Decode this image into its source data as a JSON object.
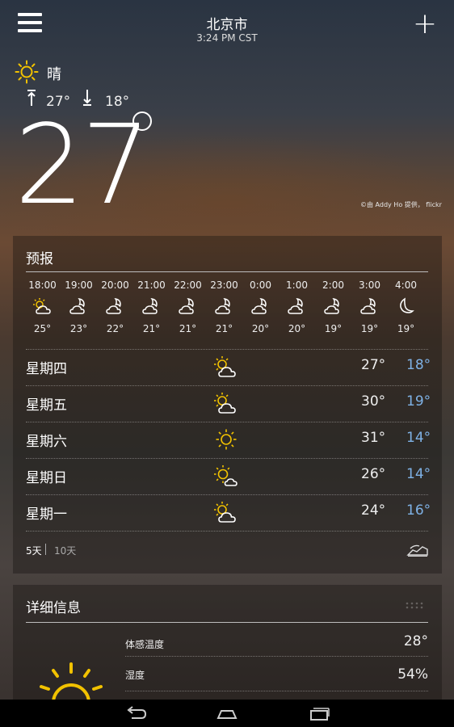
{
  "header": {
    "city": "北京市",
    "time": "3:24 PM CST",
    "menu_icon": "menu-icon",
    "add_icon": "plus-icon",
    "add_label": "+"
  },
  "current": {
    "condition": "晴",
    "condition_icon": "sun-icon",
    "high": "27°",
    "low": "18°",
    "temp": "27",
    "photo_credit": "©由 Addy Ho 提供， flickr"
  },
  "forecast": {
    "title": "预报",
    "hourly": [
      {
        "time": "18:00",
        "icon": "partly-sunny-icon",
        "temp": "25°"
      },
      {
        "time": "19:00",
        "icon": "moon-cloud-icon",
        "temp": "23°"
      },
      {
        "time": "20:00",
        "icon": "moon-cloud-icon",
        "temp": "22°"
      },
      {
        "time": "21:00",
        "icon": "moon-cloud-icon",
        "temp": "21°"
      },
      {
        "time": "22:00",
        "icon": "moon-cloud-icon",
        "temp": "21°"
      },
      {
        "time": "23:00",
        "icon": "moon-cloud-icon",
        "temp": "21°"
      },
      {
        "time": "0:00",
        "icon": "moon-cloud-icon",
        "temp": "20°"
      },
      {
        "time": "1:00",
        "icon": "moon-cloud-icon",
        "temp": "20°"
      },
      {
        "time": "2:00",
        "icon": "moon-cloud-icon",
        "temp": "19°"
      },
      {
        "time": "3:00",
        "icon": "moon-cloud-icon",
        "temp": "19°"
      },
      {
        "time": "4:00",
        "icon": "moon-icon",
        "temp": "19°"
      }
    ],
    "daily": [
      {
        "day": "星期四",
        "icon": "partly-sunny-icon",
        "high": "27°",
        "low": "18°"
      },
      {
        "day": "星期五",
        "icon": "partly-sunny-icon",
        "high": "30°",
        "low": "19°"
      },
      {
        "day": "星期六",
        "icon": "sun-icon",
        "high": "31°",
        "low": "14°"
      },
      {
        "day": "星期日",
        "icon": "sun-cloud-icon",
        "high": "26°",
        "low": "14°"
      },
      {
        "day": "星期一",
        "icon": "partly-sunny-icon",
        "high": "24°",
        "low": "16°"
      }
    ],
    "tab_5": "5天",
    "tab_10": "10天",
    "radar_icon": "radar-map-icon"
  },
  "details": {
    "title": "详细信息",
    "rows": [
      {
        "label": "体感温度",
        "value": "28°"
      },
      {
        "label": "湿度",
        "value": "54%"
      }
    ]
  },
  "navbar": {
    "icons": [
      "back-icon",
      "home-icon",
      "recent-apps-icon"
    ]
  },
  "colors": {
    "low_temp": "#7fb2e6",
    "sun": "#f2c200"
  }
}
